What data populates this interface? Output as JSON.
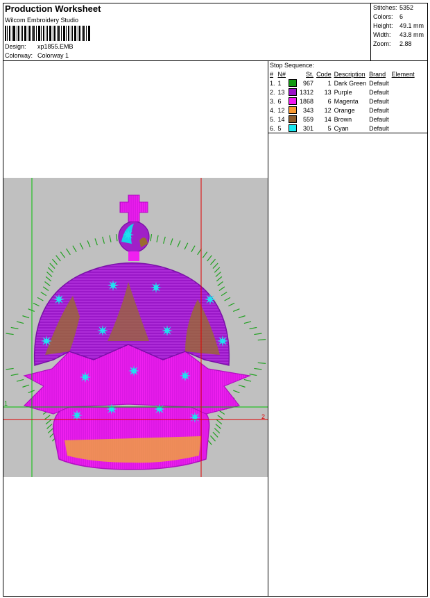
{
  "header": {
    "title": "Production Worksheet",
    "software": "Wilcom Embroidery Studio",
    "design_label": "Design:",
    "design_value": "xp1855.EMB",
    "colorway_label": "Colorway:",
    "colorway_value": "Colorway 1"
  },
  "stats": [
    {
      "label": "Stitches:",
      "value": "5352"
    },
    {
      "label": "Colors:",
      "value": "6"
    },
    {
      "label": "Height:",
      "value": "49.1 mm"
    },
    {
      "label": "Width:",
      "value": "43.8 mm"
    },
    {
      "label": "Zoom:",
      "value": "2.88"
    }
  ],
  "stop_sequence": {
    "label": "Stop Sequence:",
    "columns": [
      "#",
      "N#",
      "St.",
      "Code",
      "Description",
      "Brand",
      "Element"
    ],
    "rows": [
      {
        "num": "1.",
        "n": "1",
        "color": "#139a13",
        "st": "967",
        "code": "1",
        "description": "Dark Green",
        "brand": "Default"
      },
      {
        "num": "2.",
        "n": "13",
        "color": "#9a10c8",
        "st": "1312",
        "code": "13",
        "description": "Purple",
        "brand": "Default"
      },
      {
        "num": "3.",
        "n": "6",
        "color": "#f018f0",
        "st": "1868",
        "code": "6",
        "description": "Magenta",
        "brand": "Default"
      },
      {
        "num": "4.",
        "n": "12",
        "color": "#f89830",
        "st": "343",
        "code": "12",
        "description": "Orange",
        "brand": "Default"
      },
      {
        "num": "5.",
        "n": "14",
        "color": "#8a5a2a",
        "st": "559",
        "code": "14",
        "description": "Brown",
        "brand": "Default"
      },
      {
        "num": "6.",
        "n": "5",
        "color": "#18e8f0",
        "st": "301",
        "code": "5",
        "description": "Cyan",
        "brand": "Default"
      }
    ]
  },
  "design_preview": {
    "marker_left": "1",
    "marker_right": "2",
    "guide_colors": {
      "green": "#00c000",
      "red": "#e00000",
      "background": "#c0c0c0"
    }
  }
}
